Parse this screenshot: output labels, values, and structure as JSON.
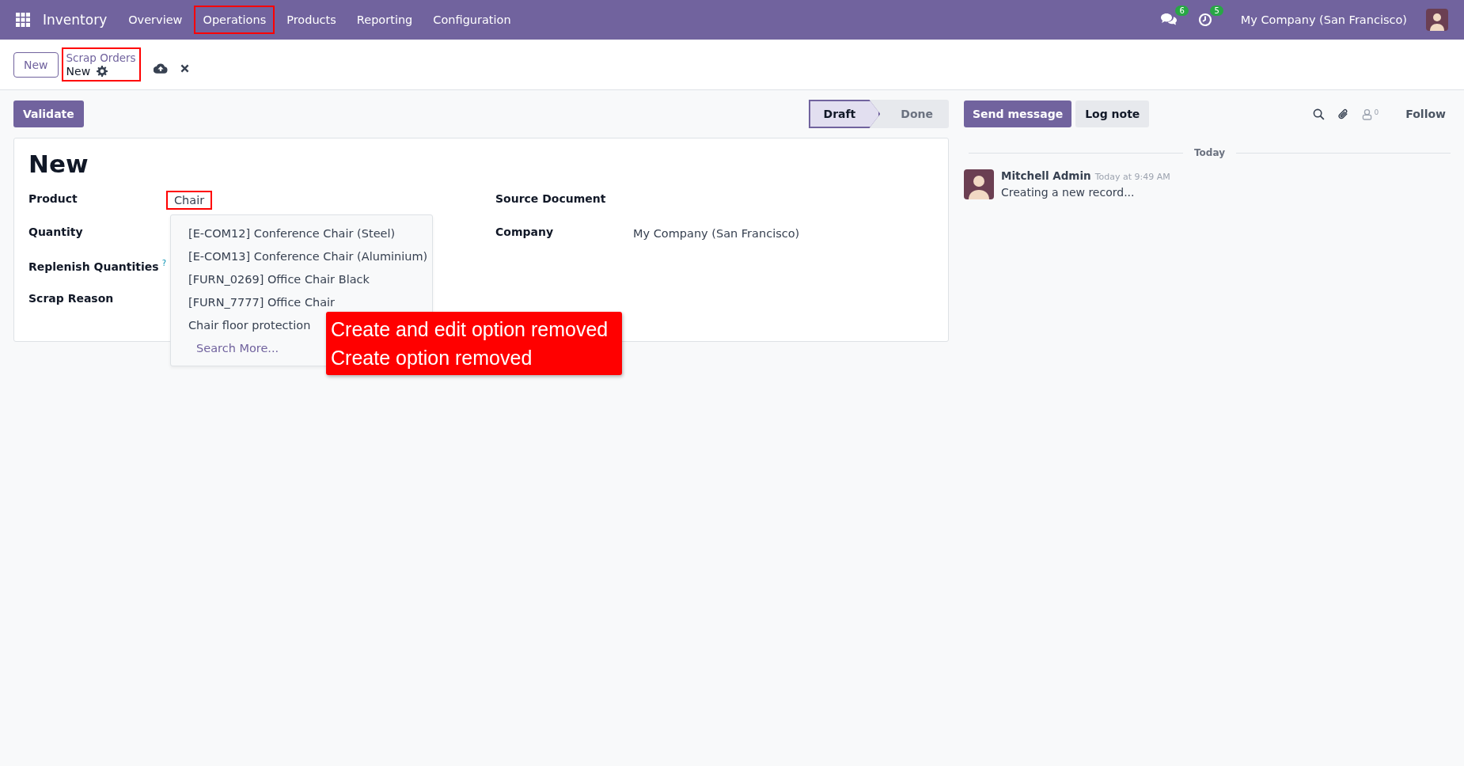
{
  "navbar": {
    "app_name": "Inventory",
    "menu": [
      {
        "label": "Overview",
        "highlighted": false
      },
      {
        "label": "Operations",
        "highlighted": true
      },
      {
        "label": "Products",
        "highlighted": false
      },
      {
        "label": "Reporting",
        "highlighted": false
      },
      {
        "label": "Configuration",
        "highlighted": false
      }
    ],
    "messages_count": "6",
    "activities_count": "5",
    "company": "My Company (San Francisco)"
  },
  "control_panel": {
    "new_button": "New",
    "breadcrumb": {
      "parent": "Scrap Orders",
      "current": "New",
      "highlighted": true
    }
  },
  "actions": {
    "validate": "Validate",
    "stages": [
      {
        "label": "Draft",
        "selected": true
      },
      {
        "label": "Done",
        "selected": false
      }
    ]
  },
  "form": {
    "title": "New",
    "left_fields": [
      {
        "label": "Product",
        "value": "Chair",
        "highlighted": true
      },
      {
        "label": "Quantity"
      },
      {
        "label": "Replenish Quantities",
        "help": "?"
      },
      {
        "label": "Scrap Reason"
      }
    ],
    "right_fields": [
      {
        "label": "Source Document"
      },
      {
        "label": "Company",
        "value": "My Company (San Francisco)"
      }
    ]
  },
  "dropdown": {
    "options": [
      "[E-COM12] Conference Chair (Steel)",
      "[E-COM13] Conference Chair (Aluminium)",
      "[FURN_0269] Office Chair Black",
      "[FURN_7777] Office Chair",
      "Chair floor protection"
    ],
    "search_more": "Search More..."
  },
  "annotation": {
    "lines": [
      "Create and edit option removed",
      "Create option removed"
    ]
  },
  "chatter": {
    "send_message": "Send message",
    "log_note": "Log note",
    "followers_count": "0",
    "follow": "Follow",
    "date_separator": "Today",
    "messages": [
      {
        "author": "Mitchell Admin",
        "time": "Today at 9:49 AM",
        "body": "Creating a new record..."
      }
    ]
  }
}
